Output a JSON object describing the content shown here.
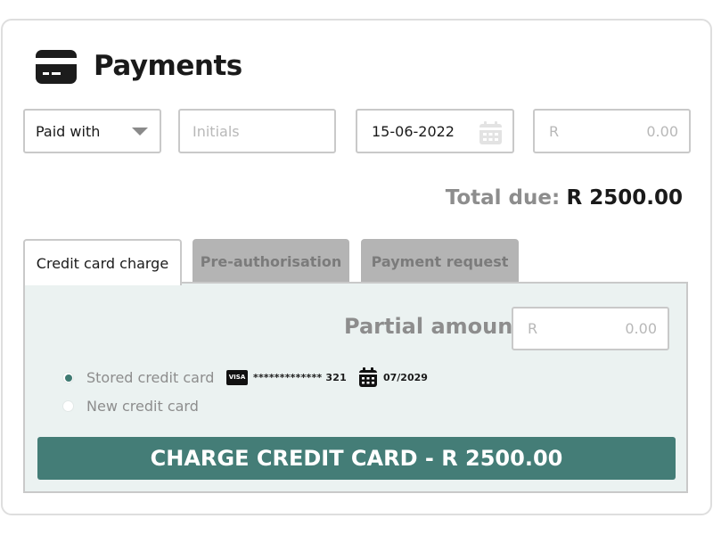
{
  "header": {
    "title": "Payments",
    "icon": "credit-card-icon"
  },
  "form": {
    "paid_with": {
      "value": "Paid with",
      "icon": "caret-down-icon"
    },
    "initials": {
      "placeholder": "Initials"
    },
    "date": {
      "value": "15-06-2022",
      "icon": "calendar-icon"
    },
    "amount": {
      "currency": "R",
      "placeholder": "0.00"
    }
  },
  "total": {
    "label": "Total due:",
    "value": "R 2500.00"
  },
  "tabs": [
    {
      "label": "Credit card charge",
      "active": true
    },
    {
      "label": "Pre-authorisation",
      "active": false
    },
    {
      "label": "Payment request",
      "active": false
    }
  ],
  "panel": {
    "partial_label": "Partial amount:",
    "partial_currency": "R",
    "partial_placeholder": "0.00",
    "options": [
      {
        "label": "Stored credit card",
        "selected": true
      },
      {
        "label": "New credit card",
        "selected": false
      }
    ],
    "stored_card": {
      "brand": "VISA",
      "masked_number": "************* 321",
      "expiry": "07/2029"
    },
    "charge_button": "CHARGE CREDIT CARD - R 2500.00"
  },
  "colors": {
    "accent": "#447d77",
    "panel_bg": "#ebf2f1",
    "muted_text": "#8d8d8d",
    "inactive_tab": "#b4b4b4"
  }
}
